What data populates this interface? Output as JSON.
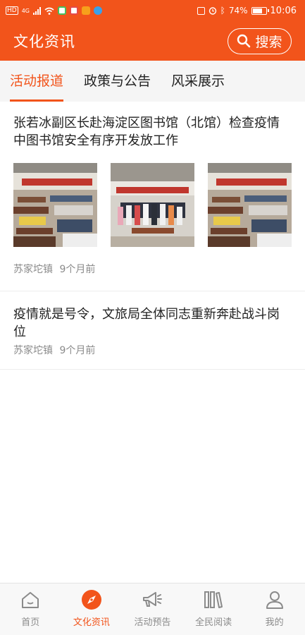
{
  "status_bar": {
    "network_label": "HD",
    "network_gen": "4G",
    "battery_percent": "74%",
    "time": "10:06"
  },
  "header": {
    "title": "文化资讯",
    "search_label": "搜索"
  },
  "tabs": [
    {
      "label": "活动报道",
      "active": true
    },
    {
      "label": "政策与公告",
      "active": false
    },
    {
      "label": "风采展示",
      "active": false
    }
  ],
  "articles": [
    {
      "title": "张若冰副区长赴海淀区图书馆（北馆）检查疫情中图书馆安全有序开发放工作",
      "source": "苏家坨镇",
      "time": "9个月前",
      "images": [
        "meeting-hall-photo",
        "group-photo",
        "meeting-hall-photo"
      ]
    },
    {
      "title": "疫情就是号令，文旅局全体同志重新奔赴战斗岗位",
      "source": "苏家坨镇",
      "time": "9个月前"
    }
  ],
  "bottom_nav": [
    {
      "label": "首页",
      "icon": "home-icon",
      "active": false
    },
    {
      "label": "文化资讯",
      "icon": "compass-icon",
      "active": true
    },
    {
      "label": "活动预告",
      "icon": "megaphone-icon",
      "active": false
    },
    {
      "label": "全民阅读",
      "icon": "books-icon",
      "active": false
    },
    {
      "label": "我的",
      "icon": "user-icon",
      "active": false
    }
  ],
  "colors": {
    "brand": "#f2541b",
    "tab_bg": "#f5f5f5",
    "meta_text": "#8a8a8a",
    "nav_inactive": "#8b8b8b"
  }
}
